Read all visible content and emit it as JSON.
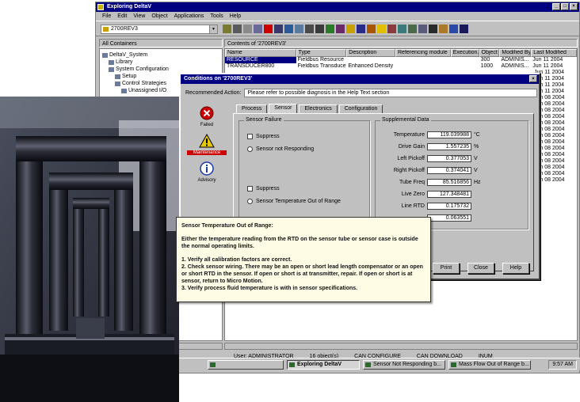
{
  "app": {
    "title": "Exploring DeltaV",
    "menu": [
      "File",
      "Edit",
      "View",
      "Object",
      "Applications",
      "Tools",
      "Help"
    ],
    "location_combo": "2700REV3"
  },
  "left_pane": {
    "header": "All Containers",
    "tree": [
      "DeltaV_System",
      "Library",
      "System Configuration",
      "Setup",
      "Control Strategies",
      "Unassigned I/O"
    ]
  },
  "right_pane": {
    "header": "Contents of '2700REV3'",
    "columns": [
      "Name",
      "Type",
      "Description",
      "Referencing module",
      "Execution...",
      "Object",
      "Modified By",
      "Last Modified"
    ],
    "rows": [
      {
        "name": "RESOURCE",
        "type": "Fieldbus Resource",
        "desc": "",
        "ref": "",
        "exec": "",
        "obj": "300",
        "mod": "ADMINIS...",
        "date": "Jun 11 2004"
      },
      {
        "name": "TRANSDUCER800",
        "type": "Fieldbus Transducer",
        "desc": "Enhanced Density",
        "ref": "",
        "exec": "",
        "obj": "1000",
        "mod": "ADMINIS...",
        "date": "Jun 11 2004"
      }
    ],
    "date_column": [
      "Jun 11 2004",
      "Jun 11 2004",
      "Jun 11 2004",
      "Jun 11 2004",
      "Jun 08 2004",
      "Jun 08 2004",
      "Jun 08 2004",
      "Jun 08 2004",
      "Jun 08 2004",
      "Jun 08 2004",
      "Jun 08 2004",
      "Jun 08 2004",
      "Jun 08 2004",
      "Jun 08 2004",
      "Jun 08 2004",
      "Jun 08 2004",
      "Jun 08 2004",
      "Jun 08 2004"
    ]
  },
  "status_bar": {
    "user": "User: ADMINISTRATOR",
    "objects": "16 object(s)",
    "mode": "CAN CONFIGURE",
    "permission": "CAN DOWNLOAD",
    "indicator": "INUM"
  },
  "taskbar": {
    "tasks": [
      "Exploring DeltaV",
      "Sensor Not Responding b...",
      "Mass Flow Out of Range b..."
    ],
    "time": "9:57 AM"
  },
  "dialog": {
    "title": "Conditions on '2700REV3'",
    "recommended_label": "Recommended Action:",
    "recommended_text": "Please refer to possible diagnosis in the Help Text section",
    "severities": [
      {
        "label": "Failed",
        "icon": "failed-icon",
        "color": "#cc0000"
      },
      {
        "label": "Maintenance",
        "icon": "warning-icon",
        "color": "#e8c800"
      },
      {
        "label": "Advisory",
        "icon": "advisory-icon",
        "color": "#1a3aa0"
      }
    ],
    "tabs": [
      "Process",
      "Sensor",
      "Electronics",
      "Configuration"
    ],
    "active_tab": "Sensor",
    "sensor_failure": {
      "title": "Sensor Failure",
      "suppress_1": "Suppress",
      "cond_1": "Sensor not Responding",
      "suppress_2": "Suppress",
      "cond_2": "Sensor Temperature Out of Range"
    },
    "supplemental": {
      "title": "Supplemental Data",
      "rows": [
        {
          "label": "Temperature",
          "value": "119.039988",
          "unit": "°C"
        },
        {
          "label": "Drive Gain",
          "value": "1.557235",
          "unit": "%"
        },
        {
          "label": "Left Pickoff",
          "value": "0.377053",
          "unit": "V"
        },
        {
          "label": "Right Pickoff",
          "value": "0.374041",
          "unit": "V"
        },
        {
          "label": "Tube Freq",
          "value": "85.516856",
          "unit": "Hz"
        },
        {
          "label": "Live Zero",
          "value": "127.348481",
          "unit": ""
        },
        {
          "label": "Line RTD",
          "value": "0.175732",
          "unit": ""
        },
        {
          "label": "",
          "value": "0.063551",
          "unit": ""
        }
      ]
    },
    "buttons": [
      "Print",
      "Close",
      "Help"
    ]
  },
  "tooltip": {
    "title": "Sensor Temperature Out of Range:",
    "body": "Either the temperature reading from the RTD on the sensor tube or sensor case is outside the normal operating limits.",
    "steps": [
      "1.  Verify all calibration factors are correct.",
      "2.  Check sensor wiring. There may be an open or short lead length compensator or an open or short RTD in the sensor. If open or short is at transmitter, repair. If open or short is at sensor, return to Micro Motion.",
      "3.  Verify process fluid temperature is with in sensor specifications."
    ]
  },
  "colors": {
    "title_bar": "#000080",
    "window_face": "#c0c0c0",
    "tooltip_bg": "#fffce6",
    "alert_red": "#cc0000"
  }
}
